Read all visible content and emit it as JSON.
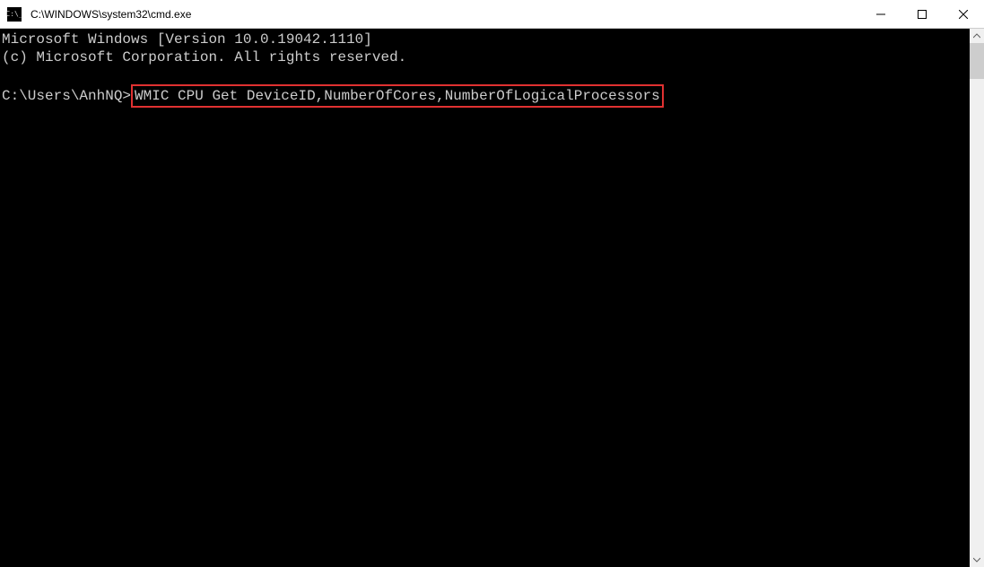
{
  "window": {
    "title": "C:\\WINDOWS\\system32\\cmd.exe",
    "icon_text": "C:\\_"
  },
  "terminal": {
    "line1": "Microsoft Windows [Version 10.0.19042.1110]",
    "line2": "(c) Microsoft Corporation. All rights reserved.",
    "blank": "",
    "prompt": "C:\\Users\\AnhNQ>",
    "command": "WMIC CPU Get DeviceID,NumberOfCores,NumberOfLogicalProcessors"
  }
}
